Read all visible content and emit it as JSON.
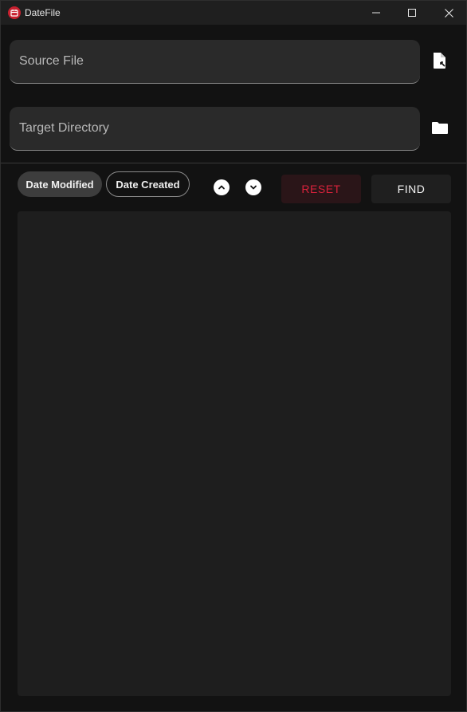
{
  "window": {
    "title": "DateFile",
    "icon": "calendar-file-icon",
    "accent_color": "#d8223b"
  },
  "source": {
    "placeholder": "Source File",
    "value": "",
    "icon": "file-select-icon"
  },
  "target": {
    "placeholder": "Target Directory",
    "value": "",
    "icon": "folder-icon"
  },
  "sort": {
    "options": [
      {
        "label": "Date Modified",
        "selected": true
      },
      {
        "label": "Date Created",
        "selected": false
      }
    ],
    "up_icon": "chevron-up-icon",
    "down_icon": "chevron-down-icon"
  },
  "actions": {
    "reset_label": "RESET",
    "find_label": "FIND",
    "reset_color": "#d8223b"
  },
  "results": {
    "items": []
  }
}
